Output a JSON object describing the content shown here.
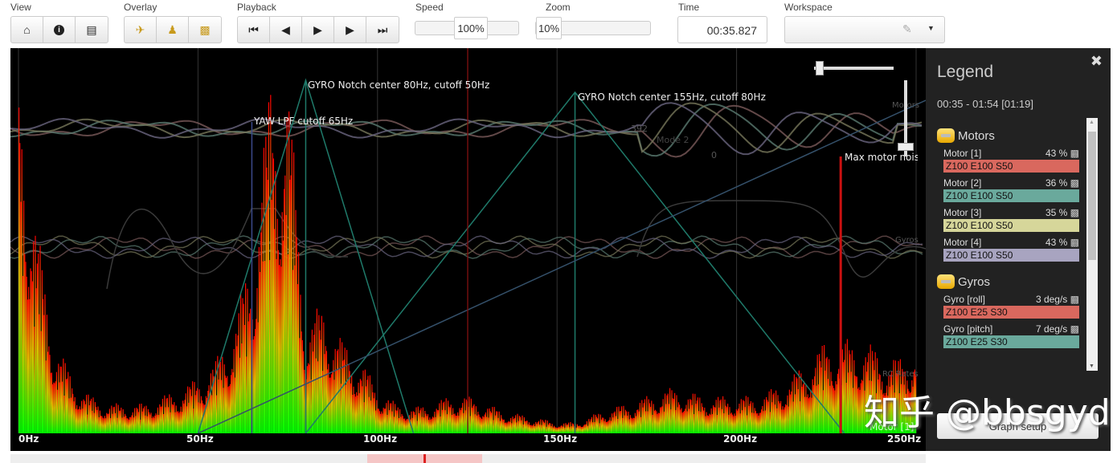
{
  "toolbar": {
    "view_label": "View",
    "overlay_label": "Overlay",
    "playback_label": "Playback",
    "speed_label": "Speed",
    "speed_value": "100%",
    "zoom_label": "Zoom",
    "zoom_value": "10%",
    "time_label": "Time",
    "time_value": "00:35.827",
    "workspace_label": "Workspace",
    "workspace_value": ""
  },
  "graph": {
    "annotations": {
      "notch1": "GYRO Notch center 80Hz, cutoff 50Hz",
      "notch2": "GYRO Notch center 155Hz, cutoff 80Hz",
      "yaw": "YAW LPF cutoff 65Hz",
      "maxnoise": "Max motor nois",
      "motors_tag": "Motors",
      "gyros_tag": "Gyros",
      "rc_tag": "RC Rates",
      "motor1_tag": "Motor [1]",
      "stick_392": "392",
      "stick_mode": "Mode 2",
      "stick_zero": "0"
    },
    "colors": {
      "spectrum_low": "#00ff00",
      "spectrum_high": "#ff0000",
      "filter": "#1f7a6a",
      "maxnoise": "#cc1111"
    }
  },
  "chart_data": {
    "type": "area",
    "title": "Gyro spectrum",
    "x_ticks": [
      "0Hz",
      "50Hz",
      "100Hz",
      "150Hz",
      "200Hz",
      "250Hz"
    ],
    "xlim": [
      0,
      250
    ],
    "ylim": [
      0,
      1
    ],
    "x": [
      0,
      5,
      10,
      15,
      20,
      25,
      30,
      35,
      40,
      45,
      50,
      55,
      60,
      65,
      70,
      75,
      80,
      85,
      90,
      95,
      100,
      105,
      110,
      115,
      120,
      125,
      130,
      135,
      140,
      145,
      150,
      155,
      160,
      165,
      170,
      175,
      180,
      185,
      190,
      195,
      200,
      205,
      210,
      215,
      220,
      225,
      230,
      235,
      240,
      245,
      250
    ],
    "values": [
      1.0,
      0.55,
      0.25,
      0.15,
      0.1,
      0.08,
      0.08,
      0.08,
      0.1,
      0.12,
      0.15,
      0.2,
      0.3,
      0.5,
      0.95,
      0.95,
      0.3,
      0.35,
      0.25,
      0.2,
      0.12,
      0.08,
      0.07,
      0.08,
      0.1,
      0.1,
      0.08,
      0.06,
      0.05,
      0.04,
      0.03,
      0.03,
      0.05,
      0.07,
      0.08,
      0.1,
      0.12,
      0.12,
      0.1,
      0.1,
      0.1,
      0.1,
      0.12,
      0.15,
      0.2,
      0.25,
      0.25,
      0.25,
      0.22,
      0.2,
      0.25
    ],
    "filters": [
      {
        "name": "notch1",
        "center": 80,
        "cutoff": 50
      },
      {
        "name": "notch2",
        "center": 155,
        "cutoff": 80
      }
    ],
    "yaw_lpf": 65,
    "max_motor_noise": 229
  },
  "legend": {
    "title": "Legend",
    "range": "00:35 - 01:54 [01:19]",
    "groups": [
      {
        "name": "Motors",
        "fields": [
          {
            "name": "Motor [1]",
            "value": "43 %",
            "setting": "Z100 E100 S50",
            "color": "#d9685e"
          },
          {
            "name": "Motor [2]",
            "value": "36 %",
            "setting": "Z100 E100 S50",
            "color": "#6aa99c"
          },
          {
            "name": "Motor [3]",
            "value": "35 %",
            "setting": "Z100 E100 S50",
            "color": "#d6d69a"
          },
          {
            "name": "Motor [4]",
            "value": "43 %",
            "setting": "Z100 E100 S50",
            "color": "#a8a4c0"
          }
        ]
      },
      {
        "name": "Gyros",
        "fields": [
          {
            "name": "Gyro [roll]",
            "value": "3 deg/s",
            "setting": "Z100 E25 S30",
            "color": "#d9685e"
          },
          {
            "name": "Gyro [pitch]",
            "value": "7 deg/s",
            "setting": "Z100 E25 S30",
            "color": "#6aa99c"
          }
        ]
      }
    ],
    "graph_setup": "Graph setup"
  },
  "watermark": "知乎 @bbsgyd"
}
